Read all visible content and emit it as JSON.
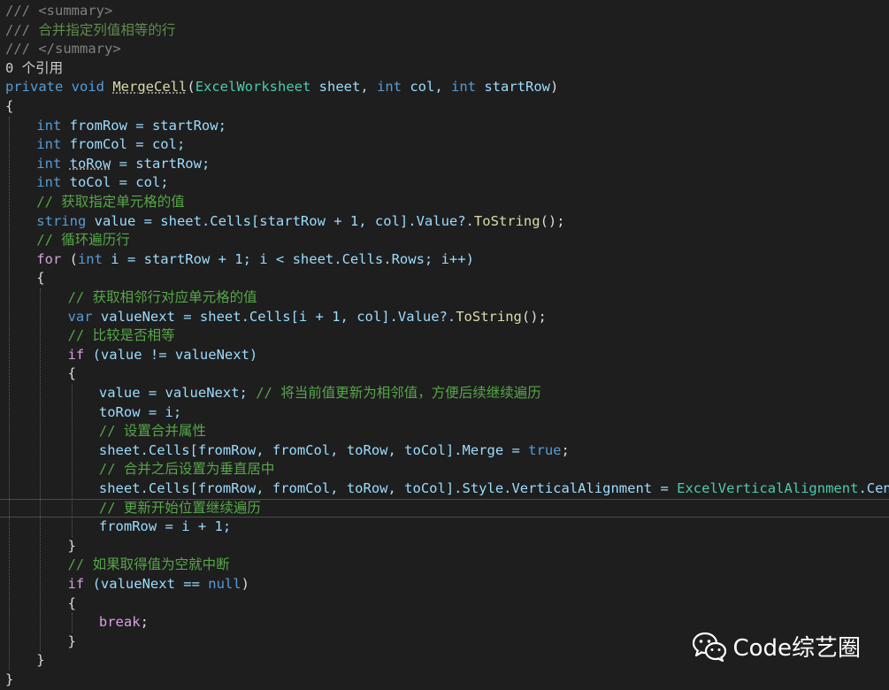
{
  "code": {
    "lines": [
      {
        "indent": 0,
        "tokens": [
          {
            "t": "/// ",
            "c": "xmlgray"
          },
          {
            "t": "<summary>",
            "c": "xmlgray"
          }
        ]
      },
      {
        "indent": 0,
        "tokens": [
          {
            "t": "/// ",
            "c": "xmlgray"
          },
          {
            "t": "合并指定列值相等的行",
            "c": "xmlcm"
          }
        ]
      },
      {
        "indent": 0,
        "tokens": [
          {
            "t": "/// ",
            "c": "xmlgray"
          },
          {
            "t": "</summary>",
            "c": "xmlgray"
          }
        ]
      },
      {
        "indent": 0,
        "tokens": [
          {
            "t": "0 个引用",
            "c": "ref"
          }
        ]
      },
      {
        "indent": 0,
        "tokens": [
          {
            "t": "private",
            "c": "kw"
          },
          {
            "t": " ",
            "c": "txtc"
          },
          {
            "t": "void",
            "c": "kw"
          },
          {
            "t": " ",
            "c": "txtc"
          },
          {
            "t": "MergeCell",
            "c": "fn",
            "u": true
          },
          {
            "t": "(",
            "c": "txtc"
          },
          {
            "t": "ExcelWorksheet",
            "c": "type"
          },
          {
            "t": " sheet, ",
            "c": "var"
          },
          {
            "t": "int",
            "c": "kw"
          },
          {
            "t": " col, ",
            "c": "var"
          },
          {
            "t": "int",
            "c": "kw"
          },
          {
            "t": " startRow",
            "c": "var"
          },
          {
            "t": ")",
            "c": "txtc"
          }
        ]
      },
      {
        "indent": 0,
        "tokens": [
          {
            "t": "{",
            "c": "txtc"
          }
        ]
      },
      {
        "indent": 1,
        "tokens": [
          {
            "t": "int",
            "c": "kw"
          },
          {
            "t": " fromRow = startRow;",
            "c": "var"
          }
        ]
      },
      {
        "indent": 1,
        "tokens": [
          {
            "t": "int",
            "c": "kw"
          },
          {
            "t": " fromCol = col;",
            "c": "var"
          }
        ]
      },
      {
        "indent": 1,
        "tokens": [
          {
            "t": "int",
            "c": "kw"
          },
          {
            "t": " ",
            "c": "var"
          },
          {
            "t": "toRow",
            "c": "var",
            "u": true
          },
          {
            "t": " = startRow;",
            "c": "var"
          }
        ]
      },
      {
        "indent": 1,
        "tokens": [
          {
            "t": "int",
            "c": "kw"
          },
          {
            "t": " toCol = col;",
            "c": "var"
          }
        ]
      },
      {
        "indent": 1,
        "tokens": [
          {
            "t": "// 获取指定单元格的值",
            "c": "cm"
          }
        ]
      },
      {
        "indent": 1,
        "tokens": [
          {
            "t": "string",
            "c": "kw"
          },
          {
            "t": " value = sheet.Cells[startRow + 1, col].Value?.",
            "c": "var"
          },
          {
            "t": "ToString",
            "c": "fn"
          },
          {
            "t": "();",
            "c": "txtc"
          }
        ]
      },
      {
        "indent": 1,
        "tokens": [
          {
            "t": "// 循环遍历行",
            "c": "cm"
          }
        ]
      },
      {
        "indent": 1,
        "tokens": [
          {
            "t": "for",
            "c": "ctl"
          },
          {
            "t": " (",
            "c": "txtc"
          },
          {
            "t": "int",
            "c": "kw"
          },
          {
            "t": " i = startRow + 1; i < sheet.Cells.Rows; i++)",
            "c": "var"
          }
        ]
      },
      {
        "indent": 1,
        "tokens": [
          {
            "t": "{",
            "c": "txtc"
          }
        ]
      },
      {
        "indent": 2,
        "tokens": [
          {
            "t": "// 获取相邻行对应单元格的值",
            "c": "cm"
          }
        ]
      },
      {
        "indent": 2,
        "tokens": [
          {
            "t": "var",
            "c": "kw"
          },
          {
            "t": " valueNext = sheet.Cells[i + 1, col].Value?.",
            "c": "var"
          },
          {
            "t": "ToString",
            "c": "fn"
          },
          {
            "t": "();",
            "c": "txtc"
          }
        ]
      },
      {
        "indent": 2,
        "tokens": [
          {
            "t": "// 比较是否相等",
            "c": "cm"
          }
        ]
      },
      {
        "indent": 2,
        "tokens": [
          {
            "t": "if",
            "c": "ctl"
          },
          {
            "t": " (value != valueNext)",
            "c": "var"
          }
        ]
      },
      {
        "indent": 2,
        "tokens": [
          {
            "t": "{",
            "c": "txtc"
          }
        ]
      },
      {
        "indent": 3,
        "tokens": [
          {
            "t": "value = valueNext; ",
            "c": "var"
          },
          {
            "t": "// 将当前值更新为相邻值，方便后续继续遍历",
            "c": "cm"
          }
        ]
      },
      {
        "indent": 3,
        "tokens": [
          {
            "t": "toRow = i;",
            "c": "var"
          }
        ]
      },
      {
        "indent": 3,
        "tokens": [
          {
            "t": "// 设置合并属性",
            "c": "cm"
          }
        ]
      },
      {
        "indent": 3,
        "tokens": [
          {
            "t": "sheet.Cells[fromRow, fromCol, toRow, toCol].Merge = ",
            "c": "var"
          },
          {
            "t": "true",
            "c": "kw"
          },
          {
            "t": ";",
            "c": "txtc"
          }
        ]
      },
      {
        "indent": 3,
        "tokens": [
          {
            "t": "// 合并之后设置为垂直居中",
            "c": "cm"
          }
        ]
      },
      {
        "indent": 3,
        "tokens": [
          {
            "t": "sheet.Cells[fromRow, fromCol, toRow, toCol].Style.VerticalAlignment = ",
            "c": "var"
          },
          {
            "t": "ExcelVerticalAlignment",
            "c": "type"
          },
          {
            "t": ".Center;",
            "c": "var"
          }
        ]
      },
      {
        "indent": 3,
        "tokens": [
          {
            "t": "// 更新开始位置继续遍历",
            "c": "cm"
          }
        ]
      },
      {
        "indent": 3,
        "tokens": [
          {
            "t": "fromRow = i + 1;",
            "c": "var"
          }
        ]
      },
      {
        "indent": 2,
        "tokens": [
          {
            "t": "}",
            "c": "txtc"
          }
        ]
      },
      {
        "indent": 2,
        "tokens": [
          {
            "t": "// 如果取得值为空就中断",
            "c": "cm"
          }
        ]
      },
      {
        "indent": 2,
        "tokens": [
          {
            "t": "if",
            "c": "ctl"
          },
          {
            "t": " (valueNext == ",
            "c": "var"
          },
          {
            "t": "null",
            "c": "kw"
          },
          {
            "t": ")",
            "c": "txtc"
          }
        ]
      },
      {
        "indent": 2,
        "tokens": [
          {
            "t": "{",
            "c": "txtc"
          }
        ]
      },
      {
        "indent": 3,
        "tokens": [
          {
            "t": "break",
            "c": "ctl"
          },
          {
            "t": ";",
            "c": "txtc"
          }
        ]
      },
      {
        "indent": 2,
        "tokens": [
          {
            "t": "}",
            "c": "txtc"
          }
        ]
      },
      {
        "indent": 1,
        "tokens": [
          {
            "t": "}",
            "c": "txtc"
          }
        ]
      },
      {
        "indent": 0,
        "tokens": [
          {
            "t": "}",
            "c": "txtc"
          }
        ]
      }
    ],
    "current_line": 26
  },
  "watermark": {
    "text": "Code综艺圈",
    "icon": "wechat-icon"
  },
  "colors": {
    "background": "#1e1e1e",
    "keyword": "#569cd6",
    "control": "#d8a0df",
    "type": "#4ec9b0",
    "comment": "#57a64a",
    "variable": "#9cdcfe",
    "method": "#dcdcaa"
  }
}
